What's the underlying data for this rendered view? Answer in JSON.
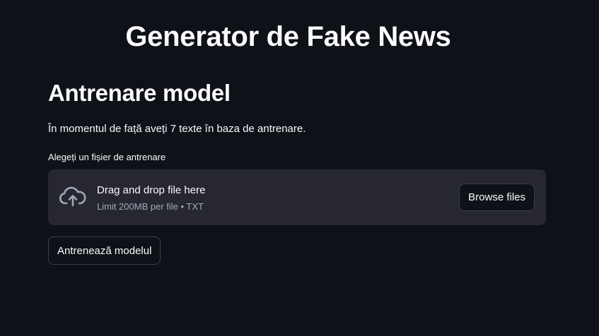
{
  "app": {
    "title": "Generator de Fake News"
  },
  "training": {
    "heading": "Antrenare model",
    "info": "În momentul de față aveți 7 texte în baza de antrenare.",
    "uploader": {
      "label": "Alegeți un fișier de antrenare",
      "drag_text": "Drag and drop file here",
      "limit_text": "Limit 200MB per file • TXT",
      "browse_label": "Browse files",
      "icon": "cloud-upload-icon"
    },
    "train_button_label": "Antrenează modelul"
  },
  "colors": {
    "background": "#0e1117",
    "dropzone": "#262730",
    "text": "#fafafa",
    "muted_text": "#a3a8b8"
  }
}
